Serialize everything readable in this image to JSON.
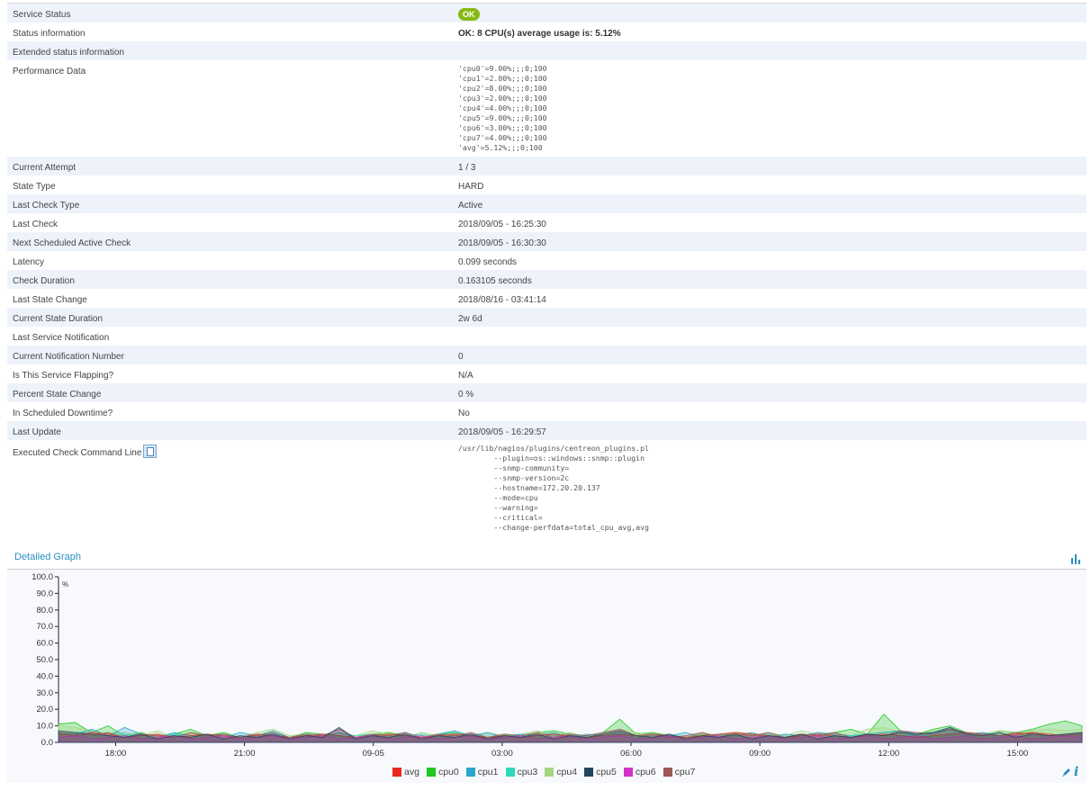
{
  "rows": [
    {
      "label": "Service Status",
      "value": "OK",
      "kind": "badge"
    },
    {
      "label": "Status information",
      "value": "OK: 8 CPU(s) average usage is: 5.12%",
      "kind": "bold"
    },
    {
      "label": "Extended status information",
      "value": "",
      "kind": "text"
    },
    {
      "label": "Performance Data",
      "value": "'cpu0'=9.00%;;;0;100\n'cpu1'=2.00%;;;0;100\n'cpu2'=8.00%;;;0;100\n'cpu3'=2.00%;;;0;100\n'cpu4'=4.00%;;;0;100\n'cpu5'=9.00%;;;0;100\n'cpu6'=3.00%;;;0;100\n'cpu7'=4.00%;;;0;100\n'avg'=5.12%;;;0;100",
      "kind": "mono"
    },
    {
      "label": "Current Attempt",
      "value": "1 / 3",
      "kind": "text"
    },
    {
      "label": "State Type",
      "value": "HARD",
      "kind": "text"
    },
    {
      "label": "Last Check Type",
      "value": "Active",
      "kind": "text"
    },
    {
      "label": "Last Check",
      "value": "2018/09/05 - 16:25:30",
      "kind": "text"
    },
    {
      "label": "Next Scheduled Active Check",
      "value": "2018/09/05 - 16:30:30",
      "kind": "text"
    },
    {
      "label": "Latency",
      "value": "0.099 seconds",
      "kind": "text"
    },
    {
      "label": "Check Duration",
      "value": "0.163105 seconds",
      "kind": "text"
    },
    {
      "label": "Last State Change",
      "value": "2018/08/16 - 03:41:14",
      "kind": "text"
    },
    {
      "label": "Current State Duration",
      "value": "2w 6d",
      "kind": "text"
    },
    {
      "label": "Last Service Notification",
      "value": "",
      "kind": "text"
    },
    {
      "label": "Current Notification Number",
      "value": "0",
      "kind": "text"
    },
    {
      "label": "Is This Service Flapping?",
      "value": "N/A",
      "kind": "text"
    },
    {
      "label": "Percent State Change",
      "value": "0 %",
      "kind": "text"
    },
    {
      "label": "In Scheduled Downtime?",
      "value": "No",
      "kind": "text"
    },
    {
      "label": "Last Update",
      "value": "2018/09/05 - 16:29:57",
      "kind": "text"
    },
    {
      "label": "Executed Check Command Line",
      "value": "/usr/lib/nagios/plugins/centreon_plugins.pl\n        --plugin=os::windows::snmp::plugin\n        --snmp-community=\n        --snmp-version=2c\n        --hostname=172.20.20.137\n        --mode=cpu\n        --warning=\n        --critical=\n        --change-perfdata=total_cpu_avg,avg",
      "kind": "mono",
      "copy_icon": "copy-clipboard-icon"
    }
  ],
  "graph": {
    "title": "Detailed Graph",
    "header_icon": "bar-chart-icon",
    "footer_icons": [
      "pencil-icon",
      "info-icon"
    ],
    "info_glyph": "i"
  },
  "chart_data": {
    "type": "area",
    "ylabel": "%",
    "ylim": [
      0,
      100
    ],
    "y_ticks": [
      "0.0",
      "10.0",
      "20.0",
      "30.0",
      "40.0",
      "50.0",
      "60.0",
      "70.0",
      "80.0",
      "90.0",
      "100.0"
    ],
    "x_ticks": [
      "18:00",
      "21:00",
      "09-05",
      "03:00",
      "06:00",
      "09:00",
      "12:00",
      "15:00"
    ],
    "x_range_hours": [
      16.67,
      40.5
    ],
    "x_tick_hours": [
      18,
      21,
      24,
      27,
      30,
      33,
      36,
      39
    ],
    "grid": false,
    "legend_position": "bottom",
    "series": [
      {
        "name": "avg",
        "color": "#e8291c",
        "values": [
          5,
          4,
          6,
          5,
          3,
          4,
          5,
          3,
          4,
          5,
          4,
          3,
          5,
          4,
          3,
          4,
          5,
          4,
          3,
          4,
          5,
          4,
          3,
          4,
          5,
          4,
          3,
          4,
          3,
          4,
          5,
          4,
          3,
          4,
          5,
          4,
          5,
          4,
          3,
          4,
          5,
          6,
          5,
          4,
          3,
          4,
          5,
          4,
          3,
          4,
          5,
          4,
          3,
          4,
          5,
          6,
          5,
          4,
          5,
          6,
          5,
          4,
          5
        ]
      },
      {
        "name": "cpu0",
        "color": "#1ec81e",
        "values": [
          11,
          12,
          6,
          10,
          4,
          6,
          3,
          5,
          8,
          4,
          6,
          3,
          5,
          4,
          3,
          6,
          5,
          4,
          2,
          5,
          6,
          4,
          3,
          5,
          6,
          4,
          3,
          5,
          4,
          6,
          7,
          5,
          4,
          6,
          14,
          5,
          6,
          4,
          3,
          5,
          4,
          6,
          5,
          4,
          3,
          5,
          4,
          6,
          8,
          5,
          17,
          7,
          5,
          8,
          10,
          6,
          5,
          7,
          6,
          8,
          11,
          13,
          10
        ]
      },
      {
        "name": "cpu1",
        "color": "#2ba7c9",
        "values": [
          6,
          5,
          8,
          4,
          9,
          5,
          3,
          6,
          4,
          5,
          3,
          6,
          4,
          7,
          3,
          5,
          4,
          6,
          3,
          5,
          4,
          6,
          3,
          5,
          7,
          4,
          6,
          3,
          5,
          4,
          6,
          3,
          5,
          4,
          6,
          3,
          5,
          4,
          6,
          3,
          5,
          4,
          6,
          3,
          5,
          4,
          6,
          5,
          4,
          5,
          6,
          7,
          5,
          6,
          8,
          5,
          6,
          4,
          5,
          6,
          4,
          5,
          6
        ]
      },
      {
        "name": "cpu3",
        "color": "#2ed9b9",
        "values": [
          4,
          5,
          3,
          4,
          5,
          3,
          4,
          5,
          3,
          4,
          5,
          3,
          4,
          5,
          3,
          4,
          5,
          3,
          4,
          5,
          3,
          4,
          5,
          3,
          4,
          5,
          3,
          4,
          5,
          3,
          4,
          5,
          3,
          4,
          5,
          3,
          4,
          5,
          3,
          4,
          5,
          3,
          4,
          5,
          3,
          4,
          5,
          3,
          4,
          5,
          3,
          4,
          5,
          3,
          4,
          5,
          3,
          4,
          5,
          3,
          4,
          5,
          4
        ]
      },
      {
        "name": "cpu4",
        "color": "#a5d67f",
        "values": [
          10,
          9,
          7,
          5,
          6,
          4,
          7,
          3,
          6,
          4,
          5,
          3,
          6,
          8,
          4,
          5,
          3,
          6,
          4,
          7,
          5,
          3,
          6,
          4,
          5,
          3,
          6,
          4,
          5,
          7,
          4,
          6,
          3,
          5,
          8,
          6,
          4,
          5,
          3,
          6,
          4,
          5,
          3,
          6,
          4,
          7,
          5,
          6,
          4,
          8,
          9,
          6,
          5,
          7,
          8,
          6,
          5,
          7,
          6,
          7,
          8,
          7,
          8
        ]
      },
      {
        "name": "cpu5",
        "color": "#24455f",
        "values": [
          7,
          6,
          5,
          4,
          3,
          5,
          2,
          4,
          3,
          5,
          2,
          4,
          3,
          5,
          2,
          4,
          3,
          9,
          2,
          4,
          3,
          5,
          2,
          4,
          3,
          5,
          2,
          4,
          3,
          5,
          2,
          4,
          3,
          5,
          7,
          4,
          3,
          5,
          2,
          4,
          3,
          5,
          2,
          4,
          3,
          5,
          2,
          4,
          3,
          5,
          4,
          6,
          5,
          6,
          9,
          5,
          4,
          6,
          3,
          5,
          4,
          5,
          6
        ]
      },
      {
        "name": "cpu6",
        "color": "#d631c6",
        "values": [
          3,
          4,
          2,
          3,
          4,
          2,
          3,
          4,
          2,
          3,
          4,
          2,
          3,
          4,
          2,
          3,
          4,
          2,
          3,
          4,
          2,
          3,
          4,
          2,
          3,
          4,
          2,
          3,
          4,
          2,
          3,
          4,
          2,
          3,
          4,
          2,
          3,
          4,
          2,
          3,
          4,
          2,
          3,
          4,
          2,
          3,
          4,
          2,
          3,
          4,
          2,
          3,
          4,
          2,
          3,
          4,
          2,
          3,
          4,
          2,
          3,
          4,
          3
        ]
      },
      {
        "name": "cpu7",
        "color": "#9e5656",
        "values": [
          6,
          5,
          4,
          6,
          3,
          5,
          4,
          3,
          6,
          4,
          5,
          3,
          4,
          6,
          3,
          5,
          4,
          8,
          3,
          5,
          4,
          6,
          3,
          5,
          4,
          6,
          3,
          5,
          4,
          6,
          3,
          5,
          4,
          6,
          8,
          4,
          5,
          3,
          4,
          6,
          3,
          5,
          4,
          6,
          3,
          5,
          4,
          6,
          3,
          5,
          4,
          7,
          6,
          5,
          8,
          6,
          5,
          4,
          6,
          5,
          4,
          5,
          6
        ]
      }
    ]
  }
}
